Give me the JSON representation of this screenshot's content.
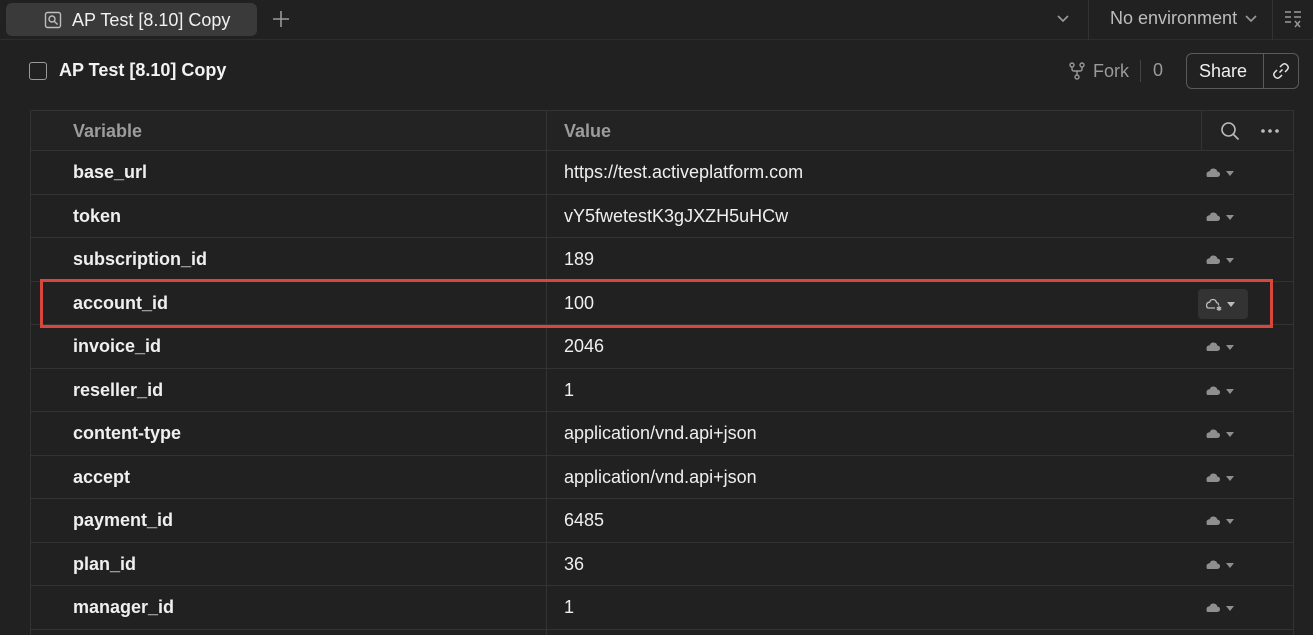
{
  "tab": {
    "title": "AP Test [8.10] Copy",
    "icon": "collection-environment-icon"
  },
  "environment": {
    "selected": "No environment"
  },
  "header": {
    "title": "AP Test [8.10] Copy",
    "fork_label": "Fork",
    "fork_count": "0",
    "share_label": "Share"
  },
  "table": {
    "columns": [
      "Variable",
      "Value"
    ],
    "rows": [
      {
        "variable": "base_url",
        "value": "https://test.activeplatform.com"
      },
      {
        "variable": "token",
        "value": "vY5fwetestK3gJXZH5uHCw"
      },
      {
        "variable": "subscription_id",
        "value": "189"
      },
      {
        "variable": "account_id",
        "value": "100"
      },
      {
        "variable": "invoice_id",
        "value": "2046"
      },
      {
        "variable": "reseller_id",
        "value": "1"
      },
      {
        "variable": "content-type",
        "value": "application/vnd.api+json"
      },
      {
        "variable": "accept",
        "value": "application/vnd.api+json"
      },
      {
        "variable": "payment_id",
        "value": "6485"
      },
      {
        "variable": "plan_id",
        "value": "36"
      },
      {
        "variable": "manager_id",
        "value": "1"
      }
    ]
  },
  "colors": {
    "background": "#212121",
    "highlight": "#d9463b",
    "tab_active": "#3a3a3a"
  }
}
